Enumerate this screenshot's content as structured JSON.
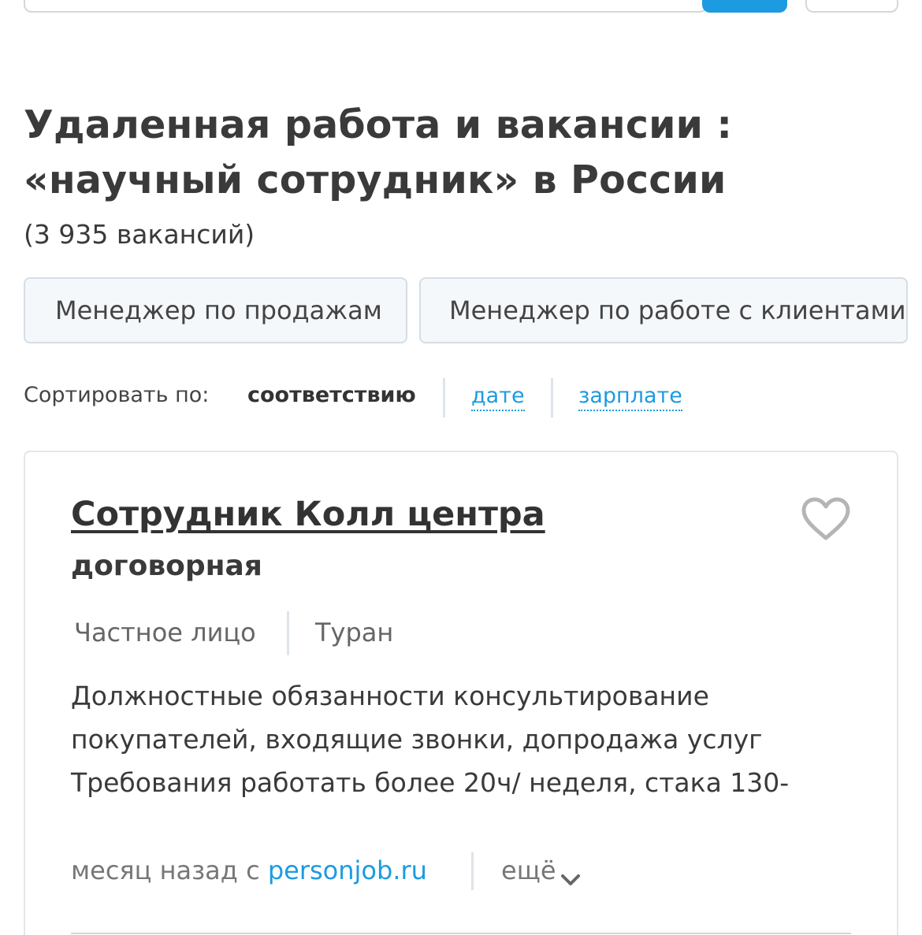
{
  "title": {
    "line1": "Удаленная работа и вакансии :",
    "line2": "«научный сотрудник» в России"
  },
  "count": "(3 935 вакансий)",
  "chips": [
    {
      "label": "Менеджер по продажам"
    },
    {
      "label": "Менеджер по работе с клиентами"
    }
  ],
  "sort": {
    "label": "Сортировать по:",
    "active": "соответствию",
    "date": "дате",
    "salary": "зарплате"
  },
  "job": {
    "title": "Сотрудник Колл центра",
    "salary": "договорная",
    "employer": "Частное лицо",
    "location": "Туран",
    "description": "Должностные обязанности консультирование покупателей, входящие звонки, допродажа услуг Требования работать более 20ч/ неделя, стака 130-",
    "posted_prefix": "месяц назад с",
    "source": "personjob.ru",
    "more": "ещё"
  },
  "icons": {
    "favorite": "heart-icon",
    "more": "chevron-down-icon"
  },
  "colors": {
    "accent": "#1c9be0",
    "text": "#333333",
    "chip_bg": "#f5f8fb"
  }
}
